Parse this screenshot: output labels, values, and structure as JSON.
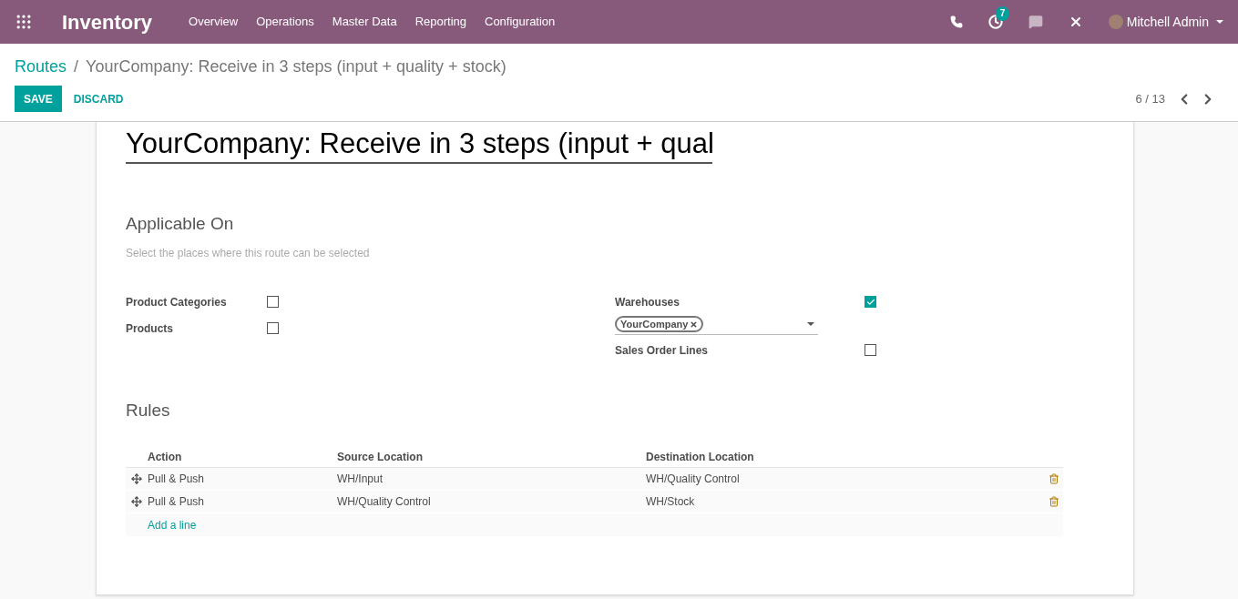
{
  "navbar": {
    "app_name": "Inventory",
    "menu": [
      "Overview",
      "Operations",
      "Master Data",
      "Reporting",
      "Configuration"
    ],
    "activity_count": "7",
    "user": "Mitchell Admin"
  },
  "breadcrumb": {
    "parent": "Routes",
    "separator": "/",
    "current": "YourCompany: Receive in 3 steps (input + quality + stock)"
  },
  "buttons": {
    "save": "SAVE",
    "discard": "DISCARD"
  },
  "pager": "6 / 13",
  "form": {
    "name": "YourCompany: Receive in 3 steps (input + qual",
    "applicable_on": {
      "title": "Applicable On",
      "help": "Select the places where this route can be selected",
      "left": [
        {
          "label": "Product Categories",
          "checked": false
        },
        {
          "label": "Products",
          "checked": false
        }
      ],
      "warehouses": {
        "label": "Warehouses",
        "checked": true,
        "tags": [
          "YourCompany"
        ]
      },
      "sales_order_lines": {
        "label": "Sales Order Lines",
        "checked": false
      }
    },
    "rules": {
      "title": "Rules",
      "columns": [
        "Action",
        "Source Location",
        "Destination Location"
      ],
      "rows": [
        {
          "action": "Pull & Push",
          "source": "WH/Input",
          "destination": "WH/Quality Control"
        },
        {
          "action": "Pull & Push",
          "source": "WH/Quality Control",
          "destination": "WH/Stock"
        }
      ],
      "add_line": "Add a line"
    }
  }
}
